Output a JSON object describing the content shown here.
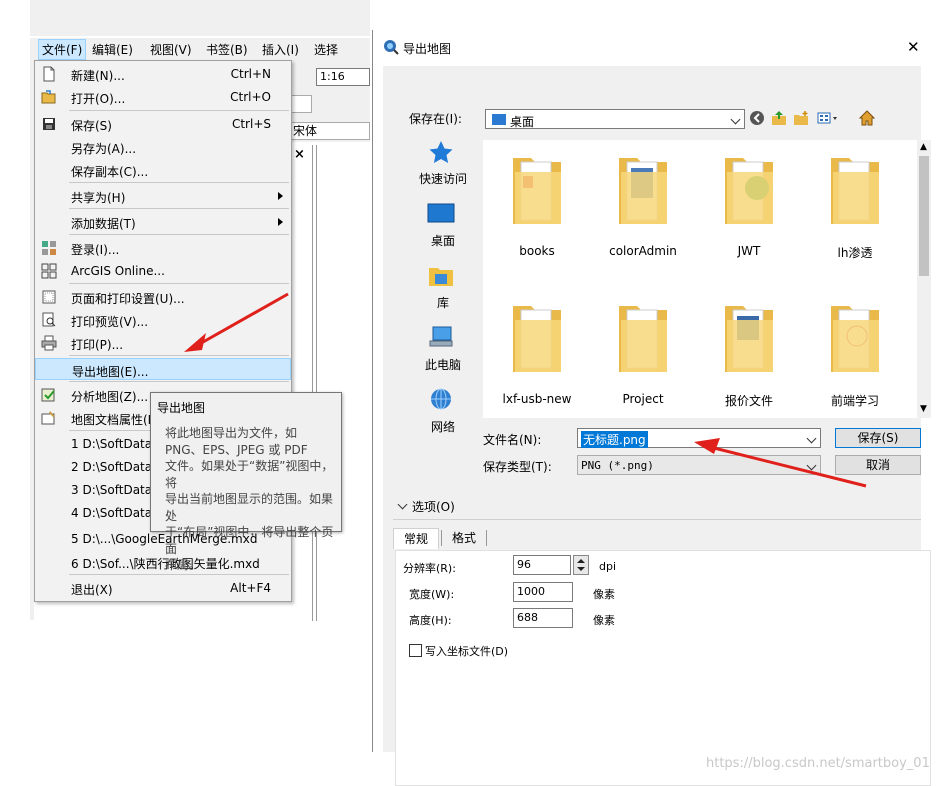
{
  "arcmap": {
    "menubar": [
      "文件(F)",
      "编辑(E)",
      "视图(V)",
      "书签(B)",
      "插入(I)",
      "选择"
    ],
    "scale_value": "1:16",
    "font_value": "宋体",
    "toc_close": "×"
  },
  "file_menu": {
    "items": [
      {
        "label": "新建(N)...",
        "shortcut": "Ctrl+N",
        "icon": "new-document-icon"
      },
      {
        "label": "打开(O)...",
        "shortcut": "Ctrl+O",
        "icon": "open-folder-icon"
      },
      {
        "label": "保存(S)",
        "shortcut": "Ctrl+S",
        "icon": "save-disk-icon"
      },
      {
        "label": "另存为(A)...",
        "shortcut": ""
      },
      {
        "label": "保存副本(C)...",
        "shortcut": ""
      },
      {
        "label": "共享为(H)",
        "shortcut": "",
        "submenu": true
      },
      {
        "label": "添加数据(T)",
        "shortcut": "",
        "submenu": true
      },
      {
        "label": "登录(I)...",
        "shortcut": "",
        "icon": "sign-in-icon"
      },
      {
        "label": "ArcGIS Online...",
        "shortcut": "",
        "icon": "arcgis-online-icon"
      },
      {
        "label": "页面和打印设置(U)...",
        "shortcut": "",
        "icon": "page-setup-icon"
      },
      {
        "label": "打印预览(V)...",
        "shortcut": "",
        "icon": "print-preview-icon"
      },
      {
        "label": "打印(P)...",
        "shortcut": "",
        "icon": "printer-icon"
      },
      {
        "label": "导出地图(E)...",
        "shortcut": "",
        "highlighted": true
      },
      {
        "label": "分析地图(Z)...",
        "shortcut": "",
        "icon": "analyze-map-icon"
      },
      {
        "label": "地图文档属性(M)...",
        "shortcut": "",
        "icon": "document-properties-icon"
      },
      {
        "label": "1 D:\\SoftData\\...",
        "shortcut": ""
      },
      {
        "label": "2 D:\\SoftData\\...",
        "shortcut": ""
      },
      {
        "label": "3 D:\\SoftData\\...",
        "shortcut": ""
      },
      {
        "label": "4 D:\\SoftData\\...",
        "shortcut": ""
      },
      {
        "label": "5 D:\\...\\GoogleEarthMerge.mxd",
        "shortcut": ""
      },
      {
        "label": "6 D:\\Sof...\\陕西行政图矢量化.mxd",
        "shortcut": ""
      },
      {
        "label": "退出(X)",
        "shortcut": "Alt+F4"
      }
    ]
  },
  "tooltip": {
    "title": "导出地图",
    "body": "将此地图导出为文件，如\nPNG、EPS、JPEG 或 PDF\n文件。如果处于“数据”视图中，将\n导出当前地图显示的范围。如果处\n于“布局”视图中，将导出整个页面\n布局。"
  },
  "dialog": {
    "title": "导出地图",
    "close": "✕",
    "save_in_label": "保存在(I):",
    "save_in_value": "桌面",
    "places": [
      {
        "label": "快速访问",
        "icon": "quick-access-star-icon"
      },
      {
        "label": "桌面",
        "icon": "desktop-icon"
      },
      {
        "label": "库",
        "icon": "library-icon"
      },
      {
        "label": "此电脑",
        "icon": "this-pc-icon"
      },
      {
        "label": "网络",
        "icon": "network-icon"
      }
    ],
    "files": [
      "books",
      "colorAdmin",
      "JWT",
      "lh渗透",
      "lxf-usb-new",
      "Project",
      "报价文件",
      "前端学习"
    ],
    "filename_label": "文件名(N):",
    "filename_value": "无标题.png",
    "filetype_label": "保存类型(T):",
    "filetype_value": "PNG (*.png)",
    "save_button": "保存(S)",
    "cancel_button": "取消",
    "options_label": "选项(O)",
    "tabs": [
      "常规",
      "格式"
    ],
    "resolution_label": "分辨率(R):",
    "resolution_value": "96",
    "resolution_unit": "dpi",
    "width_label": "宽度(W):",
    "width_value": "1000",
    "width_unit": "像素",
    "height_label": "高度(H):",
    "height_value": "688",
    "height_unit": "像素",
    "worldfile_label": "写入坐标文件(D)"
  },
  "watermark": "https://blog.csdn.net/smartboy_01",
  "colors": {
    "highlight": "#cce8ff",
    "accent": "#0078d7",
    "annotation_arrow": "#e0201b",
    "folder": "#f5d26b"
  }
}
